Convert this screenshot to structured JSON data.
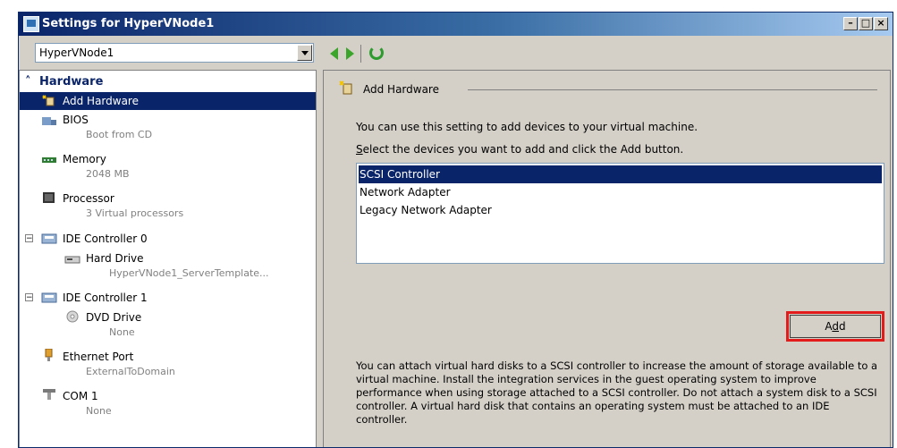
{
  "window": {
    "title": "Settings for HyperVNode1"
  },
  "toolbar": {
    "vm_selector_value": "HyperVNode1"
  },
  "hardware_tree": {
    "section_label": "Hardware",
    "items": [
      {
        "label": "Add Hardware",
        "sub": ""
      },
      {
        "label": "BIOS",
        "sub": "Boot from CD"
      },
      {
        "label": "Memory",
        "sub": "2048 MB"
      },
      {
        "label": "Processor",
        "sub": "3 Virtual processors"
      },
      {
        "label": "IDE Controller 0",
        "sub": ""
      },
      {
        "label": "Hard Drive",
        "sub": "HyperVNode1_ServerTemplate..."
      },
      {
        "label": "IDE Controller 1",
        "sub": ""
      },
      {
        "label": "DVD Drive",
        "sub": "None"
      },
      {
        "label": "Ethernet Port",
        "sub": "ExternalToDomain"
      },
      {
        "label": "COM 1",
        "sub": "None"
      }
    ]
  },
  "add_hardware": {
    "group_title": "Add Hardware",
    "description": "You can use this setting to add devices to your virtual machine.",
    "instruction_prefix": "",
    "instruction_underlined": "S",
    "instruction_rest": "elect the devices you want to add and click the Add button.",
    "devices": [
      "SCSI Controller",
      "Network Adapter",
      "Legacy Network Adapter"
    ],
    "selected_device": "SCSI Controller",
    "add_button_prefix": "A",
    "add_button_underlined": "d",
    "add_button_suffix": "d",
    "info_text": "You can attach virtual hard disks to a SCSI controller to increase the amount of storage available to a virtual machine. Install the integration services in the guest operating system to improve performance when using storage attached to a SCSI controller. Do not attach a system disk to a SCSI controller. A virtual hard disk that contains an operating system must be attached to an IDE controller."
  },
  "colors": {
    "selection": "#0a246a",
    "highlight_box": "#e31b1b",
    "nav_arrow": "#3aa52a"
  }
}
